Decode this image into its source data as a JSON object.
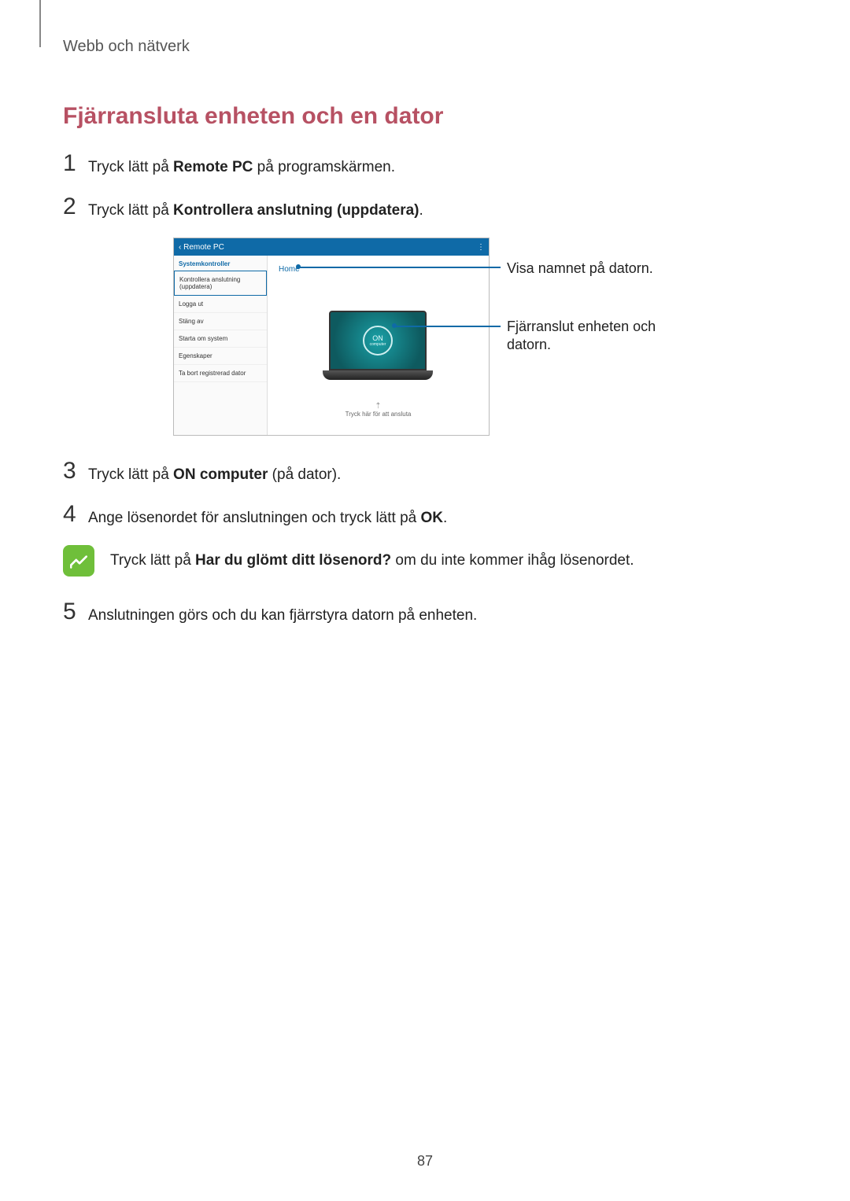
{
  "breadcrumb": "Webb och nätverk",
  "section_title": "Fjärransluta enheten och en dator",
  "steps": {
    "s1": {
      "num": "1",
      "pre": "Tryck lätt på ",
      "bold": "Remote PC",
      "post": " på programskärmen."
    },
    "s2": {
      "num": "2",
      "pre": "Tryck lätt på ",
      "bold": "Kontrollera anslutning (uppdatera)",
      "post": "."
    },
    "s3": {
      "num": "3",
      "pre": "Tryck lätt på ",
      "bold": "ON computer",
      "post": " (på dator)."
    },
    "s4": {
      "num": "4",
      "pre": "Ange lösenordet för anslutningen och tryck lätt på ",
      "bold": "OK",
      "post": "."
    },
    "s5": {
      "num": "5",
      "text": "Anslutningen görs och du kan fjärrstyra datorn på enheten."
    }
  },
  "note": {
    "pre": "Tryck lätt på ",
    "bold": "Har du glömt ditt lösenord?",
    "post": " om du inte kommer ihåg lösenordet."
  },
  "figure": {
    "app_title": "Remote PC",
    "sidebar_header": "Systemkontroller",
    "sidebar_items": [
      "Kontrollera anslutning (uppdatera)",
      "Logga ut",
      "Stäng av",
      "Starta om system",
      "Egenskaper",
      "Ta bort registrerad dator"
    ],
    "home_label": "Home",
    "on_label": "ON",
    "on_sub": "computer",
    "tap_hint": "Tryck här för att ansluta",
    "callout_top": "Visa namnet på datorn.",
    "callout_bottom": "Fjärranslut enheten och datorn."
  },
  "page_number": "87"
}
